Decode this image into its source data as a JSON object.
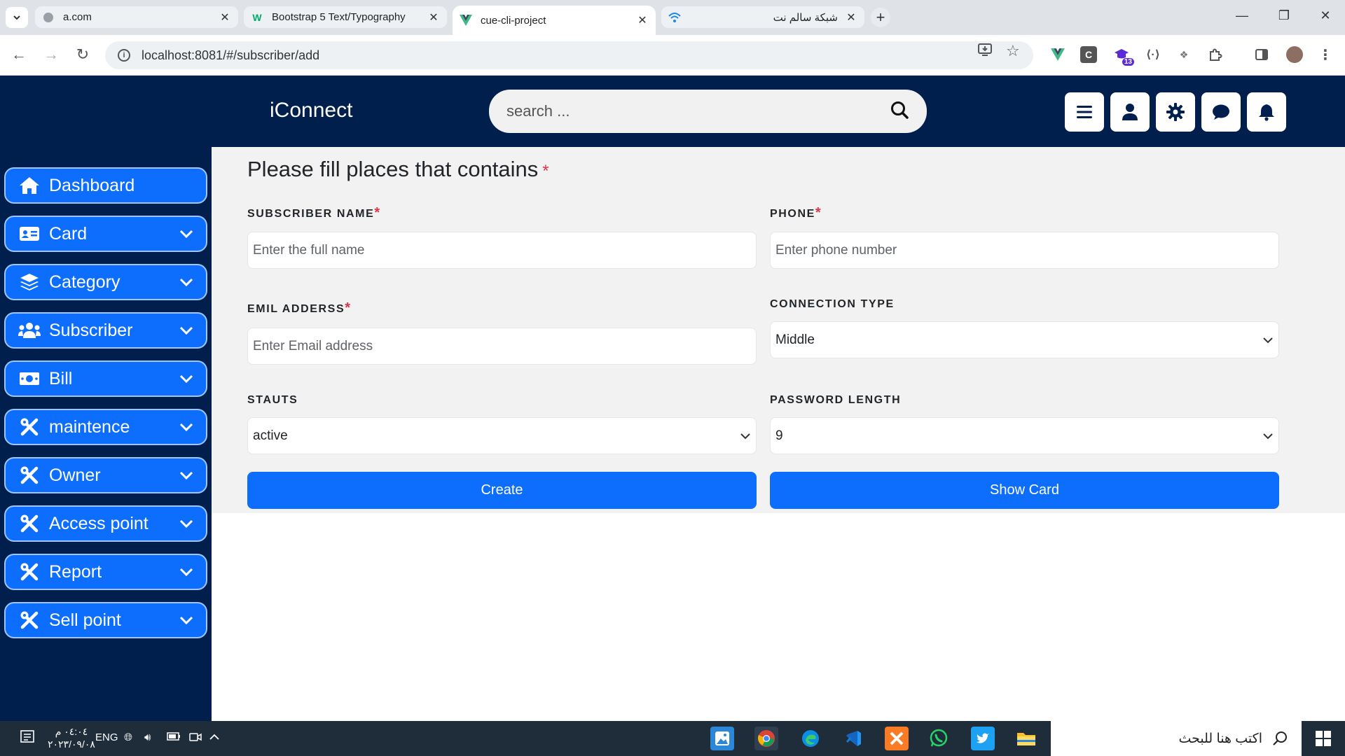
{
  "browser": {
    "tabs": [
      {
        "title": "a.com"
      },
      {
        "title": "Bootstrap 5 Text/Typography"
      },
      {
        "title": "cue-cli-project"
      },
      {
        "title": "شبكة سالم نت"
      }
    ],
    "url": "localhost:8081/#/subscriber/add",
    "extension_badge": "13"
  },
  "header": {
    "brand": "iConnect",
    "search_placeholder": "search ..."
  },
  "sidebar": {
    "items": [
      {
        "label": "Dashboard",
        "icon": "home-icon",
        "has_chevron": false
      },
      {
        "label": "Card",
        "icon": "id-card-icon",
        "has_chevron": true
      },
      {
        "label": "Category",
        "icon": "layers-icon",
        "has_chevron": true
      },
      {
        "label": "Subscriber",
        "icon": "users-icon",
        "has_chevron": true
      },
      {
        "label": "Bill",
        "icon": "money-bill-icon",
        "has_chevron": true
      },
      {
        "label": "maintence",
        "icon": "tools-icon",
        "has_chevron": true
      },
      {
        "label": "Owner",
        "icon": "tools-icon",
        "has_chevron": true
      },
      {
        "label": "Access point",
        "icon": "tools-icon",
        "has_chevron": true
      },
      {
        "label": "Report",
        "icon": "tools-icon",
        "has_chevron": true
      },
      {
        "label": "Sell point",
        "icon": "tools-icon",
        "has_chevron": true
      }
    ]
  },
  "form": {
    "title": "Please fill places that contains",
    "required_mark": "*",
    "subscriber_name": {
      "label": "SUBSCRIBER NAME",
      "placeholder": "Enter the full name",
      "value": ""
    },
    "phone": {
      "label": "PHONE",
      "placeholder": "Enter phone number",
      "value": ""
    },
    "email": {
      "label": "EMIL ADDERSS",
      "placeholder": "Enter Email address",
      "value": ""
    },
    "connection_type": {
      "label": "CONNECTION TYPE",
      "value": "Middle"
    },
    "status": {
      "label": "STAUTS",
      "value": "active"
    },
    "password_length": {
      "label": "PASSWORD LENGTH",
      "value": "9"
    },
    "create_button": "Create",
    "show_card_button": "Show Card"
  },
  "taskbar": {
    "search_placeholder": "اكتب هنا للبحث",
    "language": "ENG",
    "time": "٠٤:٠٤ م",
    "date": "٢٠٢٣/٠٩/٠٨"
  },
  "colors": {
    "navy": "#001f4d",
    "primary": "#0d6efd",
    "required": "#dc3545",
    "form_bg": "#f2f2f2"
  }
}
